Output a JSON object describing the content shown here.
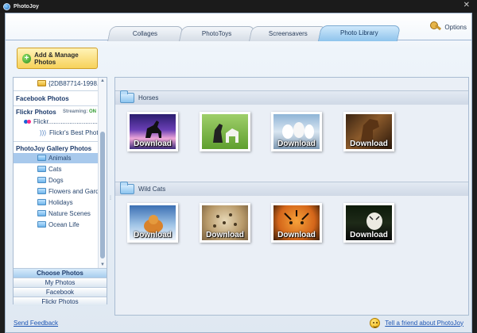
{
  "window": {
    "title": "PhotoJoy"
  },
  "tabs": [
    {
      "label": "Collages",
      "active": false
    },
    {
      "label": "PhotoToys",
      "active": false
    },
    {
      "label": "Screensavers",
      "active": false
    },
    {
      "label": "Photo Library",
      "active": true
    }
  ],
  "options": {
    "label": "Options"
  },
  "toolbar": {
    "add_manage_label": "Add & Manage Photos"
  },
  "sidebar": {
    "tree": {
      "guid_folder": "{2DB87714-1998...",
      "facebook_header": "Facebook Photos",
      "flickr_header": "Flickr Photos",
      "streaming_label": "Streaming:",
      "streaming_value": "ON",
      "flickr_item": "Flickr...............................",
      "flickr_best": "Flickr's Best Photos",
      "gallery_header": "PhotoJoy Gallery Photos",
      "gallery_items": [
        "Animals",
        "Cats",
        "Dogs",
        "Flowers and Gard...",
        "Holidays",
        "Nature Scenes",
        "Ocean Life"
      ],
      "selected_index": 0
    },
    "nav_buttons": [
      {
        "label": "Choose Photos",
        "active": true
      },
      {
        "label": "My Photos",
        "active": false
      },
      {
        "label": "Facebook",
        "active": false
      },
      {
        "label": "Flickr Photos",
        "active": false
      }
    ]
  },
  "gallery": {
    "groups": [
      {
        "name": "Horses",
        "photo_count": 4,
        "download_label": "Download"
      },
      {
        "name": "Wild Cats",
        "photo_count": 4,
        "download_label": "Download"
      }
    ]
  },
  "footer": {
    "send_feedback": "Send Feedback",
    "tell_friend": "Tell a friend about PhotoJoy"
  },
  "colors": {
    "active_tab": "#8ec4ec",
    "add_button": "#f7d25a",
    "selection": "#a8c9ec",
    "link": "#1e55b3"
  }
}
